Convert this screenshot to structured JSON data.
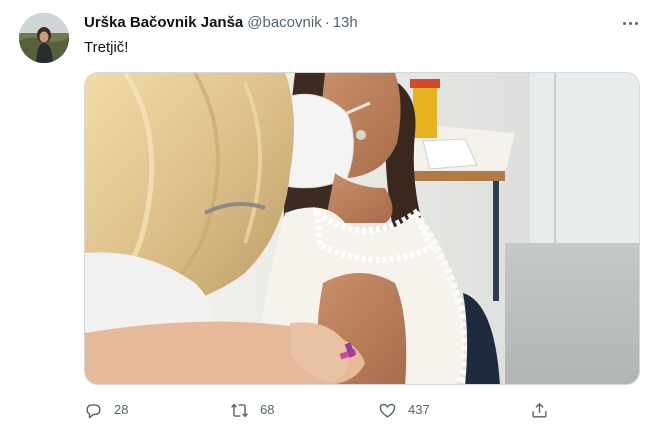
{
  "tweet": {
    "author_name": "Urška Bačovnik Janša",
    "handle": "@bacovnik",
    "separator": "·",
    "time": "13h",
    "text": "Tretjič!"
  },
  "actions": {
    "reply": {
      "icon": "reply-icon",
      "count": "28"
    },
    "retweet": {
      "icon": "retweet-icon",
      "count": "68"
    },
    "like": {
      "icon": "like-icon",
      "count": "437"
    },
    "share": {
      "icon": "share-icon"
    }
  },
  "colors": {
    "text_primary": "#0f1419",
    "text_secondary": "#536471",
    "border": "#cfd9de"
  }
}
